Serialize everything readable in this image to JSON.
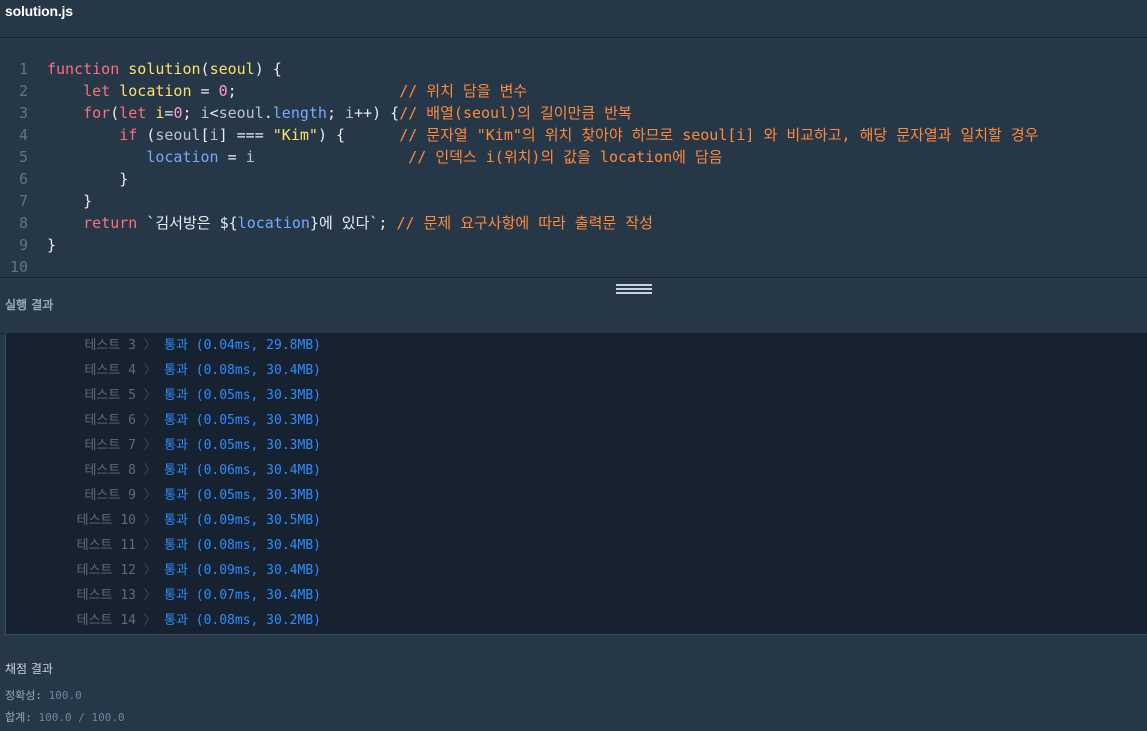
{
  "tab": {
    "filename": "solution.js"
  },
  "editor": {
    "line_numbers": [
      "1",
      "2",
      "3",
      "4",
      "5",
      "6",
      "7",
      "8",
      "9",
      "10"
    ],
    "code": {
      "l1": {
        "kw": "function",
        "name": "solution",
        "open": "(",
        "param": "seoul",
        "close": ") {"
      },
      "l2": {
        "kw": "let",
        "var": "location",
        "eq": " = ",
        "num": "0",
        "semi": ";",
        "comment": "// 위치 담을 변수"
      },
      "l3": {
        "kw1": "for",
        "p1": "(",
        "kw2": "let",
        "v1": "i",
        "eq": "=",
        "num": "0",
        "s1": "; ",
        "v2": "i",
        "lt": "<",
        "obj": "seoul",
        "dot": ".",
        "prop": "length",
        "s2": "; ",
        "v3": "i",
        "inc": "++) {",
        "comment": "// 배열(seoul)의 길이만큼 반복"
      },
      "l4": {
        "kw": "if",
        "p1": " (",
        "obj": "seoul",
        "b1": "[",
        "idx": "i",
        "b2": "]",
        "op": " === ",
        "str": "\"Kim\"",
        "p2": ") {",
        "comment": "// 문자열 \"Kim\"의 위치 찾아야 하므로 seoul[i] 와 비교하고, 해당 문자열과 일치할 경우"
      },
      "l5": {
        "var": "location",
        "eq": " = ",
        "val": "i",
        "comment": "// 인덱스 i(위치)의 값을 location에 담음"
      },
      "l6": {
        "brace": "}"
      },
      "l7": {
        "brace": "}"
      },
      "l8": {
        "kw": "return",
        "tpl1": " `김서방은 ",
        "interp_open": "${",
        "interp_var": "location",
        "interp_close": "}",
        "tpl2": "에 있다`",
        "semi": "; ",
        "comment": "// 문제 요구사항에 따라 출력문 작성"
      },
      "l9": {
        "brace": "}"
      }
    }
  },
  "run_result": {
    "title": "실행 결과",
    "separator": "〉",
    "rows": [
      {
        "label": "테스트 3",
        "value": "통과 (0.04ms, 29.8MB)"
      },
      {
        "label": "테스트 4",
        "value": "통과 (0.08ms, 30.4MB)"
      },
      {
        "label": "테스트 5",
        "value": "통과 (0.05ms, 30.3MB)"
      },
      {
        "label": "테스트 6",
        "value": "통과 (0.05ms, 30.3MB)"
      },
      {
        "label": "테스트 7",
        "value": "통과 (0.05ms, 30.3MB)"
      },
      {
        "label": "테스트 8",
        "value": "통과 (0.06ms, 30.4MB)"
      },
      {
        "label": "테스트 9",
        "value": "통과 (0.05ms, 30.3MB)"
      },
      {
        "label": "테스트 10",
        "value": "통과 (0.09ms, 30.5MB)"
      },
      {
        "label": "테스트 11",
        "value": "통과 (0.08ms, 30.4MB)"
      },
      {
        "label": "테스트 12",
        "value": "통과 (0.09ms, 30.4MB)"
      },
      {
        "label": "테스트 13",
        "value": "통과 (0.07ms, 30.4MB)"
      },
      {
        "label": "테스트 14",
        "value": "통과 (0.08ms, 30.2MB)"
      }
    ]
  },
  "grading": {
    "title": "채점 결과",
    "accuracy_label": "정확성:",
    "accuracy_value": "100.0",
    "total_label": "합계:",
    "total_value": "100.0 / 100.0"
  }
}
